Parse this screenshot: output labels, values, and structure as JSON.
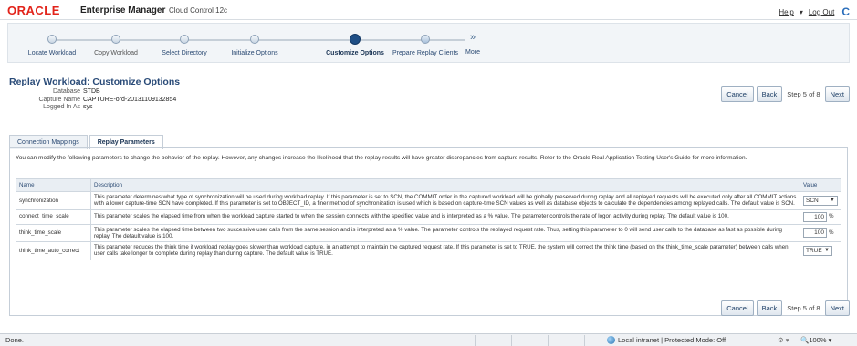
{
  "header": {
    "brand": "ORACLE",
    "product": "Enterprise Manager",
    "subtitle": "Cloud Control 12c",
    "help_label": "Help",
    "logout_label": "Log Out",
    "icon_glyph": "C"
  },
  "train": {
    "steps": [
      {
        "label": "Locate Workload",
        "state": "visited"
      },
      {
        "label": "Copy Workload",
        "state": "done"
      },
      {
        "label": "Select Directory",
        "state": "visited"
      },
      {
        "label": "Initialize Options",
        "state": "visited"
      },
      {
        "label": "Customize Options",
        "state": "current"
      },
      {
        "label": "Prepare Replay Clients",
        "state": "next"
      },
      {
        "label": "More",
        "state": "more"
      }
    ]
  },
  "page": {
    "title": "Replay Workload: Customize Options",
    "meta": [
      {
        "key": "Database",
        "value": "STDB"
      },
      {
        "key": "Capture Name",
        "value": "CAPTURE-ord-20131109132854"
      },
      {
        "key": "Logged In As",
        "value": "sys"
      }
    ]
  },
  "actions": {
    "cancel": "Cancel",
    "back": "Back",
    "step": "Step 5 of 8",
    "next": "Next"
  },
  "tabs": [
    {
      "label": "Connection Mappings",
      "active": false
    },
    {
      "label": "Replay Parameters",
      "active": true
    }
  ],
  "panel": {
    "description": "You can modify the following parameters to change the behavior of the replay. However, any changes increase the likelihood that the replay results will have greater discrepancies from capture results.  Refer to the Oracle Real Application Testing User's Guide for more information.",
    "columns": [
      "Name",
      "Description",
      "Value"
    ],
    "rows": [
      {
        "name": "synchronization",
        "description": "This parameter determines what type of synchronization will be used during workload replay. If this parameter is set to SCN, the COMMIT order in the captured workload will be globally preserved during replay and all replayed requests will be executed only after all COMMIT actions with a lower capture-time SCN have completed. If this parameter is set to OBJECT_ID, a finer method of synchronization is used which is based on capture-time SCN values as well as database objects to calculate the dependencies among replayed calls. The default value is SCN.",
        "value": "SCN",
        "kind": "select"
      },
      {
        "name": "connect_time_scale",
        "description": "This parameter scales the elapsed time from when the workload capture started to when the session connects with the specified value and is interpreted as a % value. The parameter controls the rate of logon activity during replay. The default value is 100.",
        "value": "100",
        "unit": "%",
        "kind": "number"
      },
      {
        "name": "think_time_scale",
        "description": "This parameter scales the elapsed time between two successive user calls from the same session and is interpreted as a % value. The parameter controls the replayed request rate. Thus, setting this parameter to 0 will send user calls to the database as fast as possible during replay. The default value is 100.",
        "value": "100",
        "unit": "%",
        "kind": "number"
      },
      {
        "name": "think_time_auto_correct",
        "description": "This parameter reduces the think time if workload replay goes slower than workload capture, in an attempt to maintain the captured request rate. If this parameter is set to TRUE, the system will correct the think time (based on the think_time_scale parameter) between calls when user calls take longer to complete during replay than during capture. The default value is TRUE.",
        "value": "TRUE",
        "kind": "select"
      }
    ]
  },
  "statusbar": {
    "status": "Done.",
    "zone": "Local intranet | Protected Mode: Off",
    "zoom": "100%"
  }
}
